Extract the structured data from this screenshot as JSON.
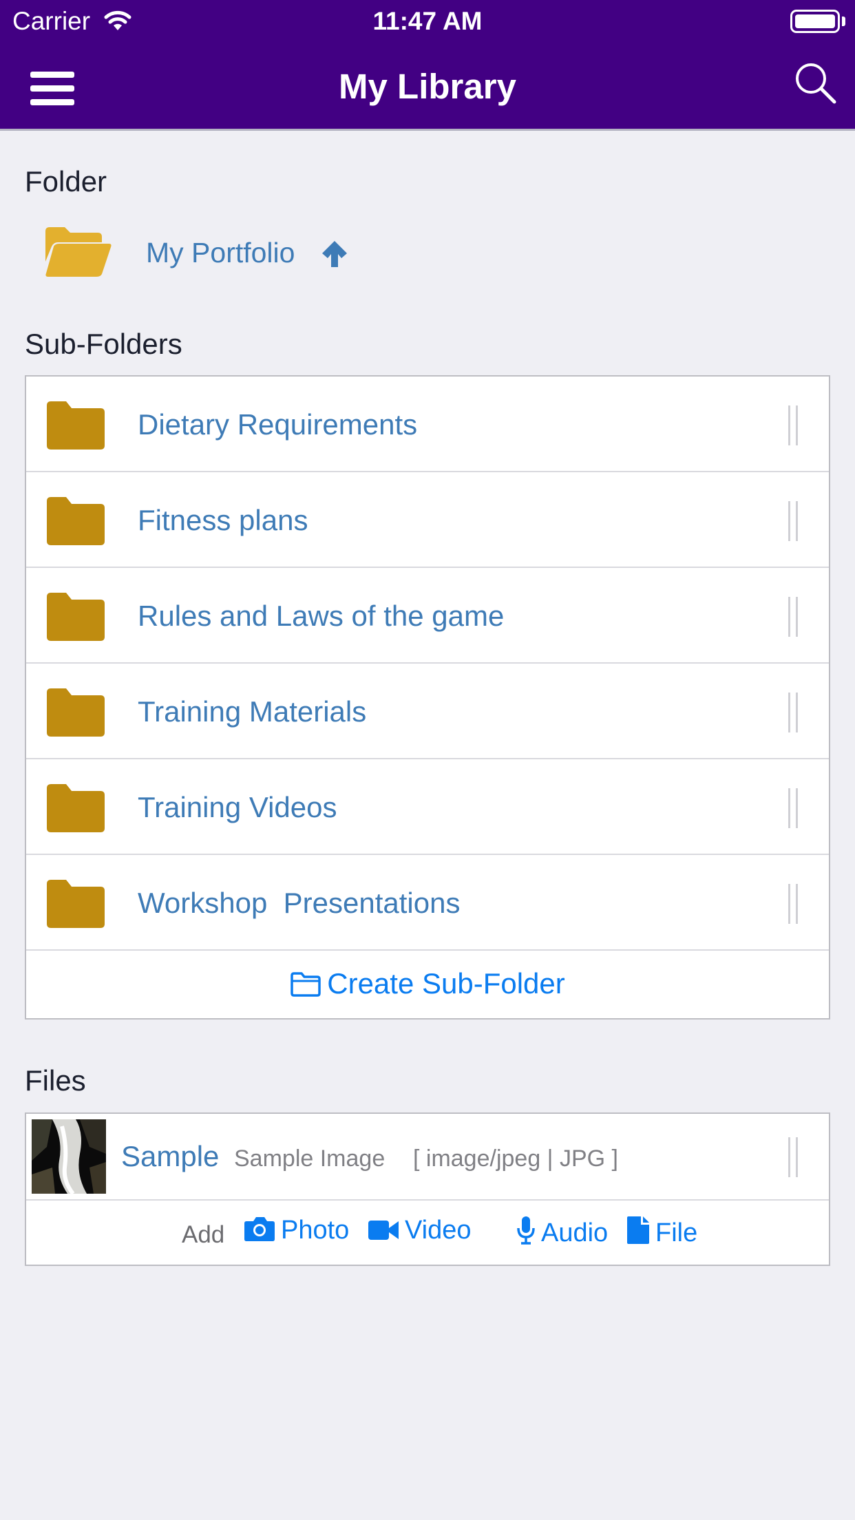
{
  "status_bar": {
    "carrier": "Carrier",
    "time": "11:47 AM"
  },
  "header": {
    "title": "My Library"
  },
  "folder_section": {
    "label": "Folder",
    "current_folder": "My Portfolio"
  },
  "subfolders_section": {
    "label": "Sub-Folders",
    "items": [
      {
        "label": "Dietary Requirements"
      },
      {
        "label": "Fitness plans"
      },
      {
        "label": "Rules and Laws of the game"
      },
      {
        "label": "Training Materials"
      },
      {
        "label": "Training Videos"
      },
      {
        "label": "Workshop  Presentations"
      }
    ],
    "create_label": "Create Sub-Folder"
  },
  "files_section": {
    "label": "Files",
    "items": [
      {
        "name": "Sample",
        "description": "Sample Image",
        "type": "[ image/jpeg | JPG ]"
      }
    ],
    "add_label": "Add",
    "add_options": {
      "photo": "Photo",
      "video": "Video",
      "audio": "Audio",
      "file": "File"
    }
  },
  "colors": {
    "header_bg": "#420083",
    "link": "#3e7bb6",
    "accent": "#0a7cf0",
    "folder_closed": "#bf8c10",
    "folder_open": "#e3b02e",
    "background": "#efeff4"
  }
}
